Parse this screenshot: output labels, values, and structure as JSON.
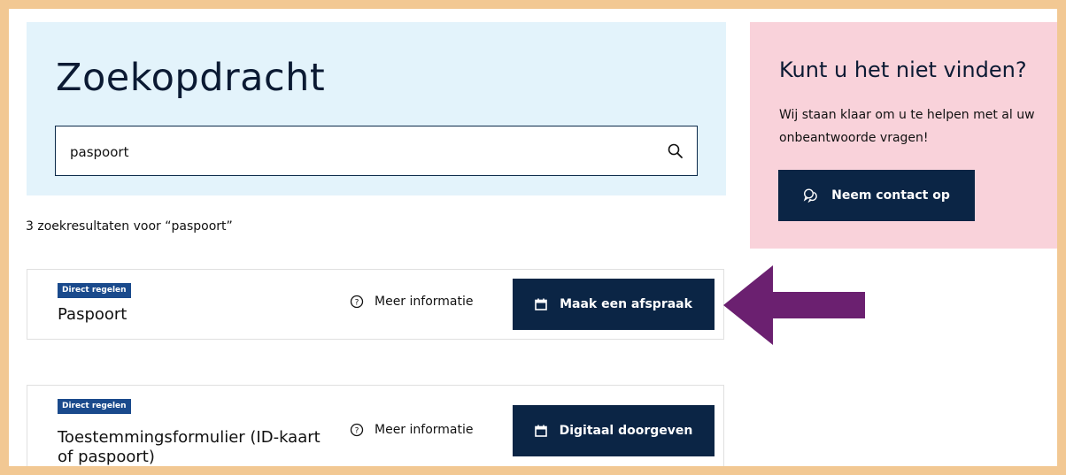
{
  "search": {
    "title": "Zoekopdracht",
    "query": "paspoort",
    "icon": "search-icon"
  },
  "results": {
    "count_text": "3 zoekresultaten voor “paspoort”",
    "items": [
      {
        "badge": "Direct regelen",
        "title": "Paspoort",
        "info_label": "Meer informatie",
        "action_label": "Maak een afspraak",
        "action_icon": "calendar-icon"
      },
      {
        "badge": "Direct regelen",
        "title": "Toestemmingsformulier (ID-kaart of paspoort)",
        "info_label": "Meer informatie",
        "action_label": "Digitaal doorgeven",
        "action_icon": "calendar-icon"
      }
    ]
  },
  "help": {
    "title": "Kunt u het niet vinden?",
    "text": "Wij staan klaar om u te helpen met al uw onbeantwoorde vragen!",
    "button_label": "Neem contact op",
    "button_icon": "chat-icon"
  },
  "colors": {
    "frame": "#f2c893",
    "search_panel": "#e3f3fb",
    "help_panel": "#f9d2da",
    "button": "#0b2545",
    "badge": "#1a4a8c",
    "arrow": "#6b2070"
  }
}
